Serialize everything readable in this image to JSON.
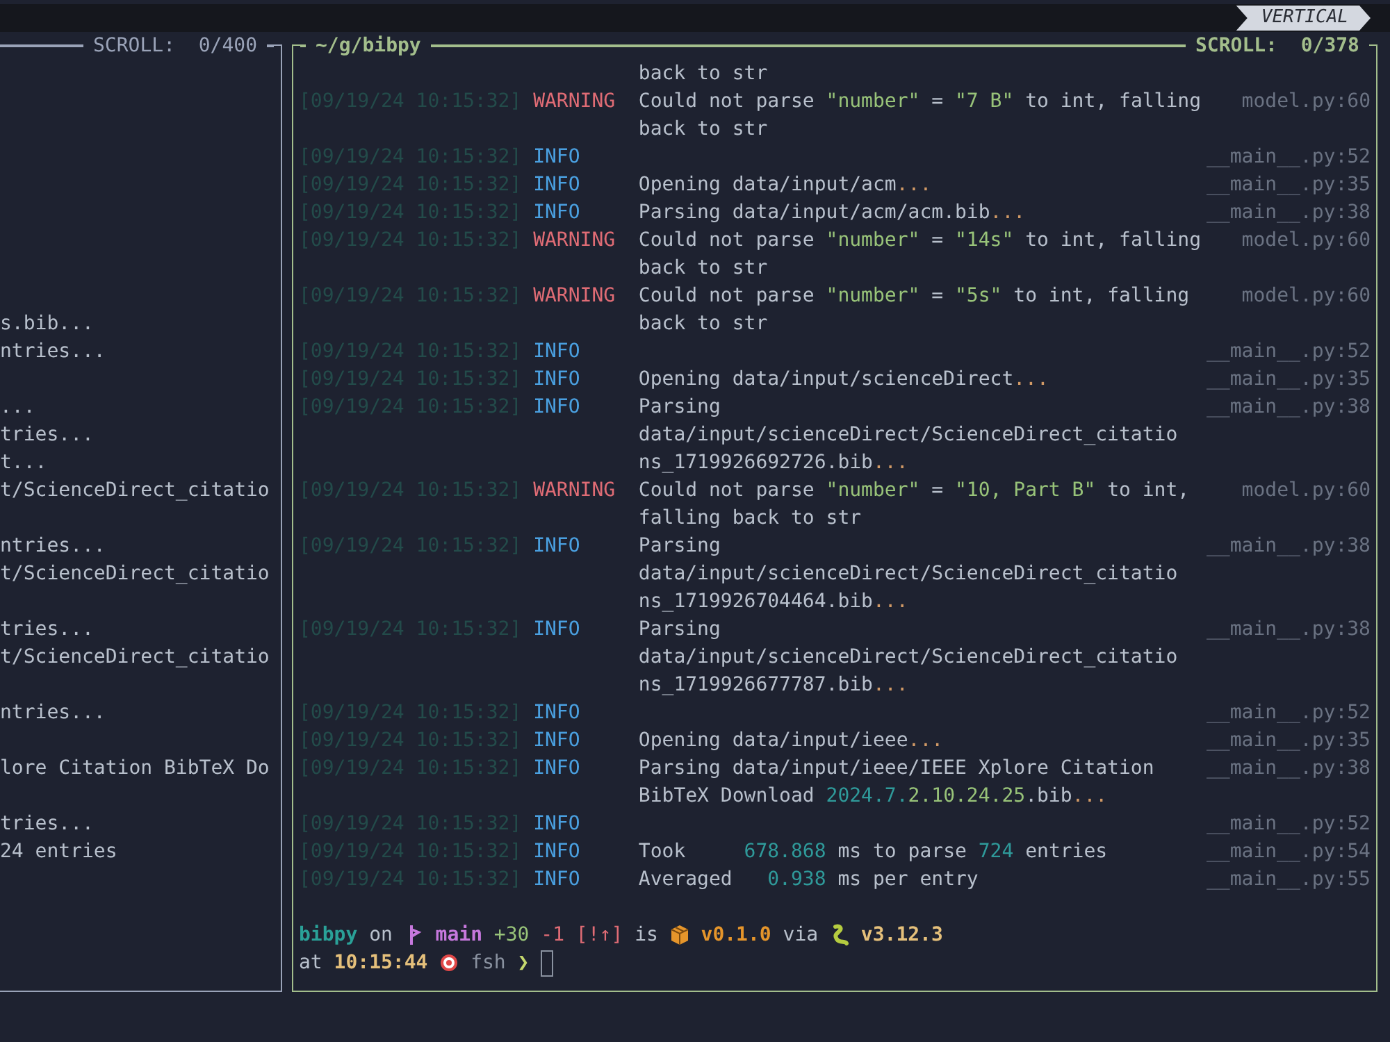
{
  "top_bar": {
    "layout_badge": "VERTICAL"
  },
  "left_pane": {
    "scroll": "SCROLL:  0/400",
    "lines": [
      {
        "kind": "blank"
      },
      {
        "kind": "blank"
      },
      {
        "kind": "blank"
      },
      {
        "kind": "blank"
      },
      {
        "kind": "blank"
      },
      {
        "kind": "blank"
      },
      {
        "kind": "blank"
      },
      {
        "kind": "blank"
      },
      {
        "kind": "blank"
      },
      {
        "kind": "text",
        "text": "s.bib..."
      },
      {
        "kind": "text",
        "text": "ntries..."
      },
      {
        "kind": "blank"
      },
      {
        "kind": "text",
        "text": "..."
      },
      {
        "kind": "text",
        "text": "tries..."
      },
      {
        "kind": "text",
        "text": "t..."
      },
      {
        "kind": "text",
        "text": "t/ScienceDirect_citatio"
      },
      {
        "kind": "blank"
      },
      {
        "kind": "text",
        "text": "ntries..."
      },
      {
        "kind": "text",
        "text": "t/ScienceDirect_citatio"
      },
      {
        "kind": "blank"
      },
      {
        "kind": "text",
        "text": "tries..."
      },
      {
        "kind": "text",
        "text": "t/ScienceDirect_citatio"
      },
      {
        "kind": "blank"
      },
      {
        "kind": "text",
        "text": "ntries..."
      },
      {
        "kind": "blank"
      },
      {
        "kind": "text",
        "text": "lore Citation BibTeX Do"
      },
      {
        "kind": "blank"
      },
      {
        "kind": "text",
        "text": "tries..."
      },
      {
        "kind": "text",
        "text": "24 entries"
      }
    ]
  },
  "right_pane": {
    "title": "~/g/bibpy",
    "scroll": "SCROLL:  0/378",
    "log": [
      {
        "kind": "continuation",
        "lines": [
          [
            {
              "kind": "plain",
              "text": "back to str"
            }
          ]
        ]
      },
      {
        "kind": "entry",
        "timestamp": "[09/19/24 10:15:32]",
        "level": "WARNING",
        "source": "model.py:60",
        "lines": [
          [
            {
              "kind": "plain",
              "text": "Could not parse "
            },
            {
              "kind": "string",
              "text": "\"number\""
            },
            {
              "kind": "plain",
              "text": " = "
            },
            {
              "kind": "string",
              "text": "\"7 B\""
            },
            {
              "kind": "plain",
              "text": " to int, falling"
            }
          ],
          [
            {
              "kind": "plain",
              "text": "back to str"
            }
          ]
        ]
      },
      {
        "kind": "entry",
        "timestamp": "[09/19/24 10:15:32]",
        "level": "INFO",
        "source": "__main__.py:52"
      },
      {
        "kind": "entry",
        "timestamp": "[09/19/24 10:15:32]",
        "level": "INFO",
        "source": "__main__.py:35",
        "lines": [
          [
            {
              "kind": "plain",
              "text": "Opening data/input/acm"
            },
            {
              "kind": "ellipsis",
              "text": "..."
            }
          ]
        ]
      },
      {
        "kind": "entry",
        "timestamp": "[09/19/24 10:15:32]",
        "level": "INFO",
        "source": "__main__.py:38",
        "lines": [
          [
            {
              "kind": "plain",
              "text": "Parsing data/input/acm/acm.bib"
            },
            {
              "kind": "ellipsis",
              "text": "..."
            }
          ]
        ]
      },
      {
        "kind": "entry",
        "timestamp": "[09/19/24 10:15:32]",
        "level": "WARNING",
        "source": "model.py:60",
        "lines": [
          [
            {
              "kind": "plain",
              "text": "Could not parse "
            },
            {
              "kind": "string",
              "text": "\"number\""
            },
            {
              "kind": "plain",
              "text": " = "
            },
            {
              "kind": "string",
              "text": "\"14s\""
            },
            {
              "kind": "plain",
              "text": " to int, falling"
            }
          ],
          [
            {
              "kind": "plain",
              "text": "back to str"
            }
          ]
        ]
      },
      {
        "kind": "entry",
        "timestamp": "[09/19/24 10:15:32]",
        "level": "WARNING",
        "source": "model.py:60",
        "lines": [
          [
            {
              "kind": "plain",
              "text": "Could not parse "
            },
            {
              "kind": "string",
              "text": "\"number\""
            },
            {
              "kind": "plain",
              "text": " = "
            },
            {
              "kind": "string",
              "text": "\"5s\""
            },
            {
              "kind": "plain",
              "text": " to int, falling"
            }
          ],
          [
            {
              "kind": "plain",
              "text": "back to str"
            }
          ]
        ]
      },
      {
        "kind": "entry",
        "timestamp": "[09/19/24 10:15:32]",
        "level": "INFO",
        "source": "__main__.py:52"
      },
      {
        "kind": "entry",
        "timestamp": "[09/19/24 10:15:32]",
        "level": "INFO",
        "source": "__main__.py:35",
        "lines": [
          [
            {
              "kind": "plain",
              "text": "Opening data/input/scienceDirect"
            },
            {
              "kind": "ellipsis",
              "text": "..."
            }
          ]
        ]
      },
      {
        "kind": "entry",
        "timestamp": "[09/19/24 10:15:32]",
        "level": "INFO",
        "source": "__main__.py:38",
        "lines": [
          [
            {
              "kind": "plain",
              "text": "Parsing"
            }
          ],
          [
            {
              "kind": "plain",
              "text": "data/input/scienceDirect/ScienceDirect_citatio"
            }
          ],
          [
            {
              "kind": "plain",
              "text": "ns_1719926692726.bib"
            },
            {
              "kind": "ellipsis",
              "text": "..."
            }
          ]
        ]
      },
      {
        "kind": "entry",
        "timestamp": "[09/19/24 10:15:32]",
        "level": "WARNING",
        "source": "model.py:60",
        "lines": [
          [
            {
              "kind": "plain",
              "text": "Could not parse "
            },
            {
              "kind": "string",
              "text": "\"number\""
            },
            {
              "kind": "plain",
              "text": " = "
            },
            {
              "kind": "string",
              "text": "\"10, Part B\""
            },
            {
              "kind": "plain",
              "text": " to int,"
            }
          ],
          [
            {
              "kind": "plain",
              "text": "falling back to str"
            }
          ]
        ]
      },
      {
        "kind": "entry",
        "timestamp": "[09/19/24 10:15:32]",
        "level": "INFO",
        "source": "__main__.py:38",
        "lines": [
          [
            {
              "kind": "plain",
              "text": "Parsing"
            }
          ],
          [
            {
              "kind": "plain",
              "text": "data/input/scienceDirect/ScienceDirect_citatio"
            }
          ],
          [
            {
              "kind": "plain",
              "text": "ns_1719926704464.bib"
            },
            {
              "kind": "ellipsis",
              "text": "..."
            }
          ]
        ]
      },
      {
        "kind": "entry",
        "timestamp": "[09/19/24 10:15:32]",
        "level": "INFO",
        "source": "__main__.py:38",
        "lines": [
          [
            {
              "kind": "plain",
              "text": "Parsing"
            }
          ],
          [
            {
              "kind": "plain",
              "text": "data/input/scienceDirect/ScienceDirect_citatio"
            }
          ],
          [
            {
              "kind": "plain",
              "text": "ns_1719926677787.bib"
            },
            {
              "kind": "ellipsis",
              "text": "..."
            }
          ]
        ]
      },
      {
        "kind": "entry",
        "timestamp": "[09/19/24 10:15:32]",
        "level": "INFO",
        "source": "__main__.py:52"
      },
      {
        "kind": "entry",
        "timestamp": "[09/19/24 10:15:32]",
        "level": "INFO",
        "source": "__main__.py:35",
        "lines": [
          [
            {
              "kind": "plain",
              "text": "Opening data/input/ieee"
            },
            {
              "kind": "ellipsis",
              "text": "..."
            }
          ]
        ]
      },
      {
        "kind": "entry",
        "timestamp": "[09/19/24 10:15:32]",
        "level": "INFO",
        "source": "__main__.py:38",
        "lines": [
          [
            {
              "kind": "plain",
              "text": "Parsing data/input/ieee/IEEE Xplore Citation"
            }
          ],
          [
            {
              "kind": "plain",
              "text": "BibTeX Download "
            },
            {
              "kind": "number",
              "text": "2024.7."
            },
            {
              "kind": "string",
              "text": "2.10.24.25"
            },
            {
              "kind": "plain",
              "text": ".bib"
            },
            {
              "kind": "ellipsis",
              "text": "..."
            }
          ]
        ]
      },
      {
        "kind": "entry",
        "timestamp": "[09/19/24 10:15:32]",
        "level": "INFO",
        "source": "__main__.py:52"
      },
      {
        "kind": "entry",
        "timestamp": "[09/19/24 10:15:32]",
        "level": "INFO",
        "source": "__main__.py:54",
        "lines": [
          [
            {
              "kind": "plain",
              "text": "Took     "
            },
            {
              "kind": "number",
              "text": "678.868"
            },
            {
              "kind": "plain",
              "text": " ms to parse "
            },
            {
              "kind": "number",
              "text": "724"
            },
            {
              "kind": "plain",
              "text": " entries"
            }
          ]
        ]
      },
      {
        "kind": "entry",
        "timestamp": "[09/19/24 10:15:32]",
        "level": "INFO",
        "source": "__main__.py:55",
        "lines": [
          [
            {
              "kind": "plain",
              "text": "Averaged   "
            },
            {
              "kind": "number",
              "text": "0.938"
            },
            {
              "kind": "plain",
              "text": " ms per entry"
            }
          ]
        ]
      }
    ],
    "prompt": {
      "cursor": true,
      "lines": [
        [
          {
            "kind": "directory",
            "text": "bibpy"
          },
          {
            "kind": "plain",
            "text": "on"
          },
          {
            "kind": "branch",
            "text": "main"
          },
          {
            "kind": "ahead",
            "text": "+30"
          },
          {
            "kind": "behind",
            "text": "-1"
          },
          {
            "kind": "status",
            "text": "[!↑]"
          },
          {
            "kind": "plain",
            "text": "is"
          },
          {
            "kind": "package",
            "text": "v0.1.0"
          },
          {
            "kind": "plain",
            "text": "via"
          },
          {
            "kind": "python",
            "text": "v3.12.3"
          }
        ],
        [
          {
            "kind": "plain",
            "text": "at"
          },
          {
            "kind": "time",
            "text": "10:15:44"
          },
          {
            "kind": "shell",
            "text": "fsh"
          },
          {
            "kind": "chevron",
            "text": "❯"
          }
        ]
      ]
    }
  }
}
